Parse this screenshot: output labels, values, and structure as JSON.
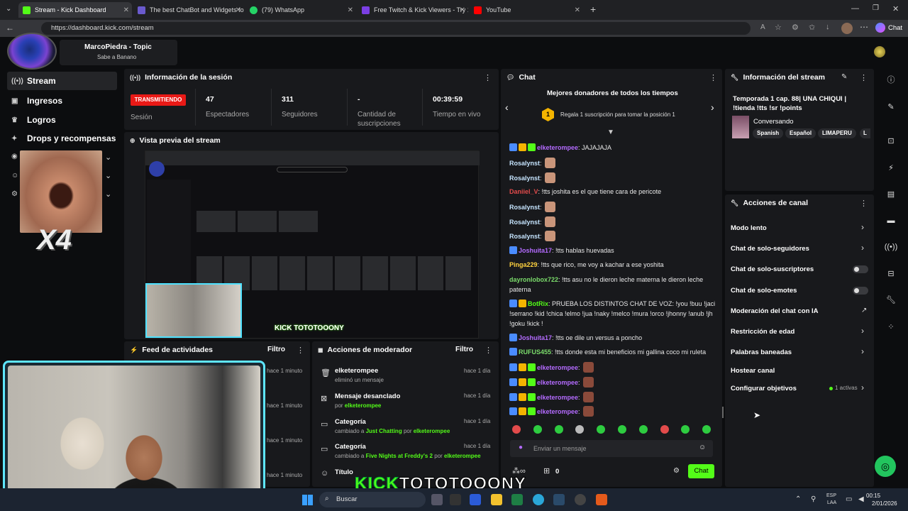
{
  "browser": {
    "tabs": [
      {
        "title": "Stream - Kick Dashboard",
        "color": "#53fc18"
      },
      {
        "title": "The best ChatBot and Widgets for",
        "color": "#6a5acd"
      },
      {
        "title": "(79) WhatsApp",
        "color": "#25d366"
      },
      {
        "title": "Free Twitch & Kick Viewers - Try 1",
        "color": "#7b3fe4"
      },
      {
        "title": "YouTube",
        "color": "#ff0000"
      }
    ],
    "url": "https://dashboard.kick.com/stream",
    "profile_label": "Chat"
  },
  "header": {
    "channel_name": "MarcoPiedra - Topic",
    "channel_subtitle": "Sabe a Banano"
  },
  "sidebar": {
    "items": [
      {
        "label": "Stream",
        "icon": "broadcast-icon"
      },
      {
        "label": "Ingresos",
        "icon": "money-icon"
      },
      {
        "label": "Logros",
        "icon": "trophy-icon"
      },
      {
        "label": "Drops y recompensas",
        "icon": "gift-icon"
      }
    ],
    "overlay_text": "X4"
  },
  "session": {
    "title": "Información de la sesión",
    "status_badge": "TRANSMITIENDO",
    "status_label": "Sesión",
    "viewers_value": "47",
    "viewers_label": "Espectadores",
    "followers_value": "311",
    "followers_label": "Seguidores",
    "subs_value": "-",
    "subs_label": "Cantidad de suscripciones",
    "time_value": "00:39:59",
    "time_label": "Tiempo en vivo"
  },
  "preview": {
    "title": "Vista previa del stream",
    "overlay_text": "KICK TOTOTOOONY"
  },
  "feed": {
    "title": "Feed de actividades",
    "filter_label": "Filtro",
    "items": [
      "hace 1 minuto",
      "hace 1 minuto",
      "hace 1 minuto",
      "hace 1 minuto"
    ]
  },
  "mod": {
    "title": "Acciones de moderador",
    "filter_label": "Filtro",
    "items": [
      {
        "title": "elketerompee",
        "sub_pre": "eliminó un mensaje",
        "sub_user": "",
        "ago": "hace 1 día",
        "icon": "trash-icon"
      },
      {
        "title": "Mensaje desanclado",
        "sub_pre": "por",
        "sub_user": "elketerompee",
        "ago": "hace 1 día",
        "icon": "pin-icon"
      },
      {
        "title": "Categoría",
        "sub_pre": "cambiado a",
        "sub_user": "Just Chatting",
        "sub_post": "por",
        "sub_user2": "elketerompee",
        "ago": "hace 1 día",
        "icon": "category-icon"
      },
      {
        "title": "Categoría",
        "sub_pre": "cambiado a",
        "sub_user": "Five Nights at Freddy's 2",
        "sub_post": "por",
        "sub_user2": "elketerompee",
        "ago": "hace 1 día",
        "icon": "category-icon"
      },
      {
        "title": "Título",
        "ago": "",
        "icon": "title-icon"
      }
    ]
  },
  "chat": {
    "title": "Chat",
    "donors_title": "Mejores donadores de todos los tiempos",
    "donors_rank": "1",
    "donors_text": "Regala 1 suscripción para tomar la posición 1",
    "messages": [
      {
        "user": "elketerompee",
        "color": "#b46bff",
        "text": ": JAJAJAJA",
        "badges": 3
      },
      {
        "user": "Rosalynst",
        "color": "#c6e5ff",
        "text": ":",
        "emote": true
      },
      {
        "user": "Rosalynst",
        "color": "#c6e5ff",
        "text": ":",
        "emote": true
      },
      {
        "user": "Daniiel_V",
        "color": "#e24b4b",
        "text": ": !tts joshita es el que tiene cara de pericote"
      },
      {
        "user": "Rosalynst",
        "color": "#c6e5ff",
        "text": ":",
        "emote": true
      },
      {
        "user": "Rosalynst",
        "color": "#c6e5ff",
        "text": ":",
        "emote": true
      },
      {
        "user": "Rosalynst",
        "color": "#c6e5ff",
        "text": ":",
        "emote": true
      },
      {
        "user": "Joshuita17",
        "color": "#b46bff",
        "text": ": !tts hablas huevadas",
        "badges": 1
      },
      {
        "user": "Pinga229",
        "color": "#ffd23f",
        "text": ": !tts que rico, me voy a kachar a ese yoshita"
      },
      {
        "user": "dayronlobox722",
        "color": "#7bdc6b",
        "text": ": !tts asu no le dieron leche materna le dieron leche paterna"
      },
      {
        "user": "BotRix",
        "color": "#53fc18",
        "text": ": PRUEBA LOS DISTINTOS CHAT DE VOZ: !you !buu !jaci !serrano !kid !chica !elmo !jua !naky !melco !mura !orco !jhonny !anub !jh !goku !kick !",
        "badges": 2
      },
      {
        "user": "Joshuita17",
        "color": "#b46bff",
        "text": ": !tts oe dile un versus a poncho",
        "badges": 1
      },
      {
        "user": "RUFUS455",
        "color": "#7bdc6b",
        "text": ": !tts donde esta mi beneficios mi gallina coco mi ruleta",
        "badges": 1
      },
      {
        "user": "elketerompee",
        "color": "#b46bff",
        "text": ":",
        "badges": 3,
        "emote": true
      },
      {
        "user": "elketerompee",
        "color": "#b46bff",
        "text": ":",
        "badges": 3,
        "emote": true
      },
      {
        "user": "elketerompee",
        "color": "#b46bff",
        "text": ":",
        "badges": 3,
        "emote": true
      },
      {
        "user": "elketerompee",
        "color": "#b46bff",
        "text": ":",
        "badges": 3,
        "emote": true
      }
    ],
    "input_placeholder": "Enviar un mensaje",
    "points_value": "0",
    "send_label": "Chat"
  },
  "stream_info": {
    "title": "Información del stream",
    "stream_title": "Temporada 1 cap. 88| UNA CHIQUI | !tienda !tts !sr !points",
    "category": "Conversando",
    "tags": [
      "Spanish",
      "Español",
      "LIMAPERU",
      "L"
    ]
  },
  "channel_actions": {
    "title": "Acciones de canal",
    "items": [
      {
        "label": "Modo lento",
        "control": "chevron"
      },
      {
        "label": "Chat de solo-seguidores",
        "control": "chevron"
      },
      {
        "label": "Chat de solo-suscriptores",
        "control": "toggle"
      },
      {
        "label": "Chat de solo-emotes",
        "control": "toggle"
      },
      {
        "label": "Moderación del chat con IA",
        "control": "external"
      },
      {
        "label": "Restricción de edad",
        "control": "chevron"
      },
      {
        "label": "Palabras baneadas",
        "control": "chevron"
      },
      {
        "label": "Hostear canal",
        "control": "none"
      },
      {
        "label": "Configurar objetivos",
        "control": "chevron",
        "extra": "1 activas"
      }
    ]
  },
  "taskbar": {
    "search_label": "Buscar",
    "lang_top": "ESP",
    "lang_bottom": "LAA",
    "time": "00:15",
    "date": "2/01/2026"
  },
  "colors": {
    "accent": "#53fc18",
    "live_red": "#e91916",
    "panel": "#18191c"
  }
}
